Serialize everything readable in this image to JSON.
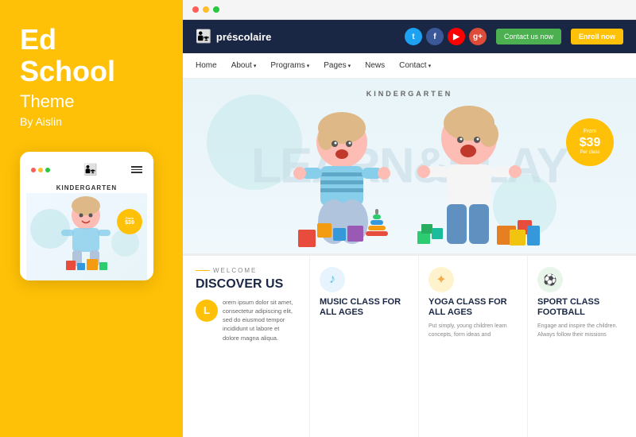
{
  "leftPanel": {
    "title": "Ed\nSchool",
    "subtitle": "Theme",
    "author": "By Aislin",
    "mobileDots": [
      "red",
      "yellow",
      "green"
    ],
    "heroLabel": "KINDERGARTEN",
    "priceBadge": {
      "from": "From",
      "value": "$39",
      "sub": "Per class"
    }
  },
  "browser": {
    "dots": [
      "red",
      "yellow",
      "green"
    ]
  },
  "nav": {
    "logoText": "préscolaire",
    "contactLabel": "Contact us now",
    "enrollLabel": "Enroll now"
  },
  "menu": {
    "items": [
      "Home",
      "About",
      "Programs",
      "Pages",
      "News",
      "Contact"
    ]
  },
  "hero": {
    "label": "KINDERGARTEN",
    "bgText": "LEARN&PLAY",
    "priceBadge": {
      "from": "From",
      "value": "$39",
      "sub": "Per class"
    }
  },
  "welcome": {
    "tag": "WELCOME",
    "title": "DISCOVER US",
    "avatarLetter": "L",
    "text": "orem ipsum dolor sit amet, consectetur adipiscing elit, sed do eiusmod tempor incididunt ut labore et dolore magna aliqua."
  },
  "features": [
    {
      "title": "MUSIC CLASS FOR ALL AGES",
      "iconColor": "#E8F4FD",
      "iconSymbol": "♪",
      "iconBg": "#5bc0de",
      "text": ""
    },
    {
      "title": "YOGA CLASS FOR ALL AGES",
      "iconColor": "#FFF3CD",
      "iconSymbol": "✦",
      "iconBg": "#f0ad4e",
      "text": "Put simply, young children learn concepts, form ideas and"
    },
    {
      "title": "SPORT CLASS FOOTBALL",
      "iconColor": "#E8F5E9",
      "iconSymbol": "⚽",
      "iconBg": "#5cb85c",
      "text": "Engage and inspire the children. Always follow their missions"
    }
  ]
}
